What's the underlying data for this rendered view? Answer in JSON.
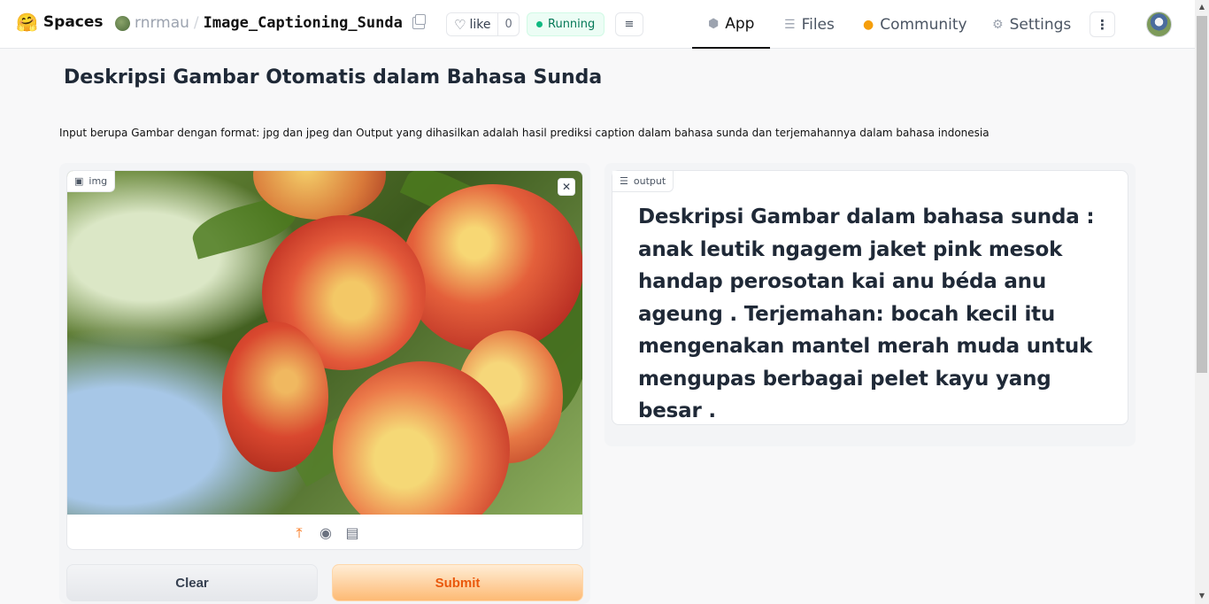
{
  "header": {
    "logo_emoji": "🤗",
    "logo_text": "Spaces",
    "owner": "rnrmau",
    "separator": "/",
    "repo_name": "Image_Captioning_Sunda",
    "like_label": "like",
    "like_count": "0",
    "status": "Running",
    "nav": [
      {
        "label": "App",
        "icon": "cube-icon"
      },
      {
        "label": "Files",
        "icon": "files-icon"
      },
      {
        "label": "Community",
        "icon": "community-icon"
      },
      {
        "label": "Settings",
        "icon": "gear-icon"
      }
    ]
  },
  "main": {
    "title": "Deskripsi Gambar Otomatis dalam Bahasa Sunda",
    "description": "Input berupa Gambar dengan format: jpg dan jpeg dan Output yang dihasilkan adalah hasil prediksi caption dalam bahasa sunda dan terjemahannya dalam bahasa indonesia",
    "image_input": {
      "label": "img",
      "image": "red-apples-on-tree"
    },
    "buttons": {
      "clear": "Clear",
      "submit": "Submit"
    },
    "output": {
      "label": "output",
      "text": "Deskripsi Gambar dalam bahasa sunda : anak leutik ngagem jaket pink mesok handap perosotan kai anu béda anu ageung . Terjemahan: bocah kecil itu mengenakan mantel merah muda untuk mengupas berbagai pelet kayu yang besar ."
    }
  },
  "colors": {
    "accent": "#f97316",
    "running_green": "#10b981"
  }
}
